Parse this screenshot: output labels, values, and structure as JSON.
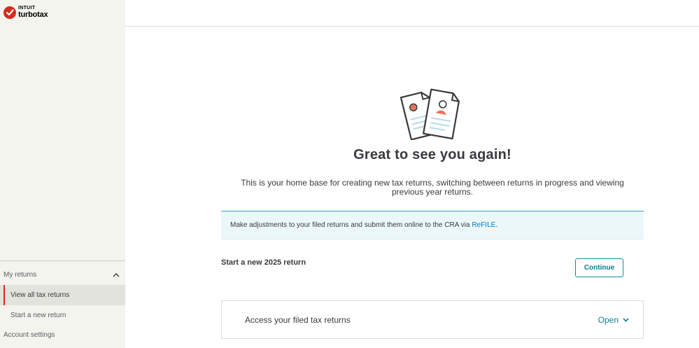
{
  "brand": {
    "company": "INTUIT",
    "product": "turbotax",
    "logo_color": "#d52b1e"
  },
  "sidebar": {
    "section_label": "My returns",
    "section_icon": "chevron-up-icon",
    "items": [
      {
        "label": "View all tax returns",
        "active": true
      },
      {
        "label": "Start a new return",
        "active": false
      }
    ],
    "account_label": "Account settings"
  },
  "main": {
    "headline": "Great to see you again!",
    "intro": "This is your home base for creating new tax returns, switching between returns in progress and viewing previous year returns.",
    "banner": {
      "text": "Make adjustments to your filed returns and submit them online to the CRA via",
      "link_label": "ReFILE",
      "suffix": "."
    },
    "start": {
      "title": "Start a new 2025 return",
      "button_label": "Continue"
    },
    "access": {
      "title": "Access your filed tax returns",
      "open_label": "Open",
      "open_icon": "chevron-down-icon"
    }
  },
  "colors": {
    "accent": "#0b7c8c",
    "brand_red": "#d52b1e",
    "banner_bg": "#ecf7fa"
  }
}
